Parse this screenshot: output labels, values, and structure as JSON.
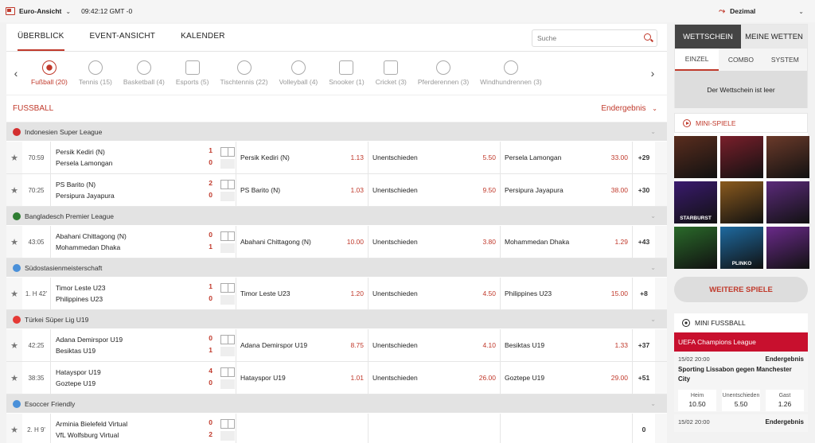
{
  "topbar": {
    "view": "Euro-Ansicht",
    "time": "09:42:12 GMT -0",
    "odds_format": "Dezimal"
  },
  "tabs": [
    "ÜBERBLICK",
    "EVENT-ANSICHT",
    "KALENDER"
  ],
  "search": {
    "placeholder": "Suche"
  },
  "sports": [
    {
      "label": "Fußball (20)",
      "icon": "soccer-ball-icon"
    },
    {
      "label": "Tennis (15)",
      "icon": "tennis-ball-icon"
    },
    {
      "label": "Basketball (4)",
      "icon": "basketball-icon"
    },
    {
      "label": "Esports (5)",
      "icon": "gamepad-icon"
    },
    {
      "label": "Tischtennis (22)",
      "icon": "table-tennis-icon"
    },
    {
      "label": "Volleyball (4)",
      "icon": "volleyball-icon"
    },
    {
      "label": "Snooker (1)",
      "icon": "snooker-icon"
    },
    {
      "label": "Cricket (3)",
      "icon": "cricket-icon"
    },
    {
      "label": "Pferderennen (3)",
      "icon": "horse-icon"
    },
    {
      "label": "Windhundrennen (3)",
      "icon": "greyhound-icon"
    }
  ],
  "section": {
    "title": "FUSSBALL",
    "market": "Endergebnis"
  },
  "leagues": [
    {
      "name": "Indonesien Super League",
      "flag_color": "#d32f2f",
      "matches": [
        {
          "time": "70:59",
          "home": "Persik Kediri (N)",
          "away": "Persela Lamongan",
          "hs": "1",
          "as": "0",
          "o1_name": "Persik Kediri (N)",
          "o1": "1.13",
          "ox_name": "Unentschieden",
          "ox": "5.50",
          "o2_name": "Persela Lamongan",
          "o2": "33.00",
          "more": "+29"
        },
        {
          "time": "70:25",
          "home": "PS Barito (N)",
          "away": "Persipura Jayapura",
          "hs": "2",
          "as": "0",
          "o1_name": "PS Barito (N)",
          "o1": "1.03",
          "ox_name": "Unentschieden",
          "ox": "9.50",
          "o2_name": "Persipura Jayapura",
          "o2": "38.00",
          "more": "+30"
        }
      ]
    },
    {
      "name": "Bangladesch Premier League",
      "flag_color": "#2e7d32",
      "matches": [
        {
          "time": "43:05",
          "home": "Abahani Chittagong (N)",
          "away": "Mohammedan Dhaka",
          "hs": "0",
          "as": "1",
          "o1_name": "Abahani Chittagong (N)",
          "o1": "10.00",
          "ox_name": "Unentschieden",
          "ox": "3.80",
          "o2_name": "Mohammedan Dhaka",
          "o2": "1.29",
          "more": "+43"
        }
      ]
    },
    {
      "name": "Südostasienmeisterschaft",
      "flag_color": "#4a90d9",
      "matches": [
        {
          "time": "1. H 42'",
          "home": "Timor Leste U23",
          "away": "Philippines U23",
          "hs": "1",
          "as": "0",
          "o1_name": "Timor Leste U23",
          "o1": "1.20",
          "ox_name": "Unentschieden",
          "ox": "4.50",
          "o2_name": "Philippines U23",
          "o2": "15.00",
          "more": "+8"
        }
      ]
    },
    {
      "name": "Türkei Süper Lig U19",
      "flag_color": "#e53935",
      "matches": [
        {
          "time": "42:25",
          "home": "Adana Demirspor U19",
          "away": "Besiktas U19",
          "hs": "0",
          "as": "1",
          "o1_name": "Adana Demirspor U19",
          "o1": "8.75",
          "ox_name": "Unentschieden",
          "ox": "4.10",
          "o2_name": "Besiktas U19",
          "o2": "1.33",
          "more": "+37"
        },
        {
          "time": "38:35",
          "home": "Hatayspor U19",
          "away": "Goztepe U19",
          "hs": "4",
          "as": "0",
          "o1_name": "Hatayspor U19",
          "o1": "1.01",
          "ox_name": "Unentschieden",
          "ox": "26.00",
          "o2_name": "Goztepe U19",
          "o2": "29.00",
          "more": "+51"
        }
      ]
    },
    {
      "name": "Esoccer Friendly",
      "flag_color": "#4a90d9",
      "matches": [
        {
          "time": "2. H 9'",
          "home": "Arminia Bielefeld Virtual",
          "away": "VfL Wolfsburg Virtual",
          "hs": "0",
          "as": "2",
          "o1_name": "",
          "o1": "",
          "ox_name": "",
          "ox": "",
          "o2_name": "",
          "o2": "",
          "more": "0"
        }
      ]
    }
  ],
  "betslip": {
    "tabs": [
      "WETTSCHEIN",
      "MEINE WETTEN"
    ],
    "subtabs": [
      "EINZEL",
      "COMBO",
      "SYSTEM"
    ],
    "empty": "Der Wettschein ist leer"
  },
  "mini_games": {
    "title": "MINI-SPIELE",
    "more_button": "WEITERE SPIELE",
    "tiles": [
      {
        "label": "",
        "color": "#5a2d1e"
      },
      {
        "label": "",
        "color": "#7a1f2b"
      },
      {
        "label": "",
        "color": "#6b3a2a"
      },
      {
        "label": "STARBURST",
        "color": "#3a1a6e"
      },
      {
        "label": "",
        "color": "#8a5a1e"
      },
      {
        "label": "",
        "color": "#5b2a7a"
      },
      {
        "label": "",
        "color": "#2a6a2a"
      },
      {
        "label": "PLINKO",
        "color": "#1e6aa0"
      },
      {
        "label": "",
        "color": "#6a2a8a"
      }
    ]
  },
  "mini_football": {
    "title": "MINI FUSSBALL",
    "league": "UEFA Champions League",
    "match1": {
      "datetime": "15/02 20:00",
      "market": "Endergebnis",
      "teams": "Sporting Lissabon  gegen Manchester City",
      "odds": [
        {
          "label": "Heim",
          "value": "10.50"
        },
        {
          "label": "Unentschieden",
          "value": "5.50"
        },
        {
          "label": "Gast",
          "value": "1.26"
        }
      ]
    },
    "match2": {
      "datetime": "15/02 20:00",
      "market": "Endergebnis"
    }
  }
}
